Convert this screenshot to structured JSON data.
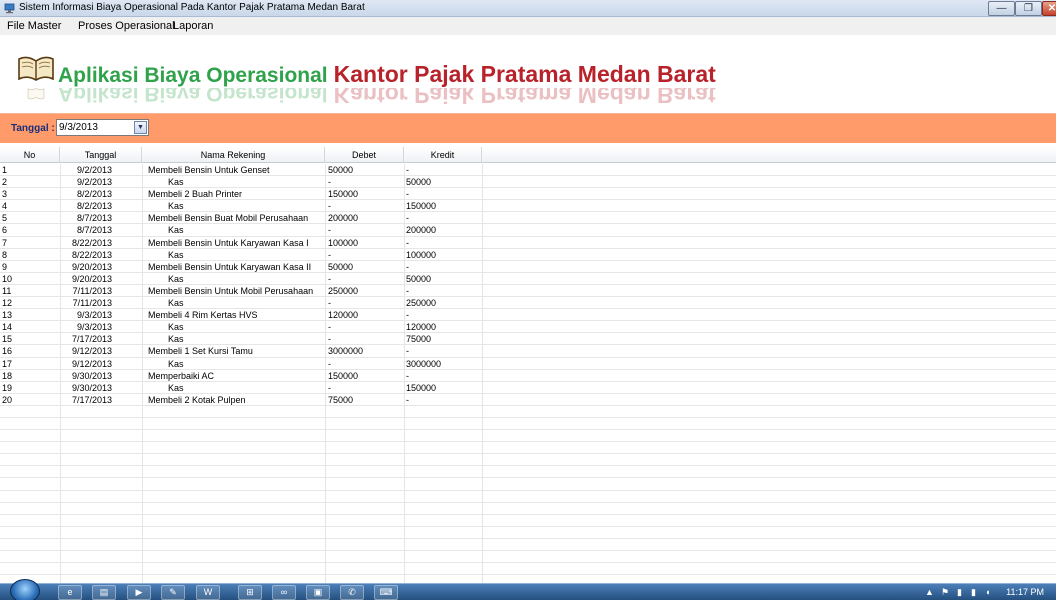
{
  "window": {
    "title": "Sistem Informasi Biaya Operasional Pada Kantor Pajak Pratama Medan Barat",
    "minimize_glyph": "—",
    "restore_glyph": "❐",
    "close_glyph": "✕"
  },
  "menu": {
    "items": [
      "File Master",
      "Proses Operasional",
      "Laporan"
    ]
  },
  "banner": {
    "title_green": "Aplikasi Biaya Operasional",
    "title_red": "Kantor Pajak Pratama Medan Barat",
    "colors": {
      "green": "#2fa24a",
      "red": "#b8222a"
    }
  },
  "filter": {
    "label": "Tanggal :",
    "date_value": "9/3/2013",
    "bar_color": "#ff9a6b"
  },
  "grid": {
    "columns": [
      "No",
      "Tanggal",
      "Nama Rekening",
      "Debet",
      "Kredit"
    ],
    "rows": [
      {
        "no": "1",
        "tanggal": "9/2/2013",
        "nama": "Membeli Bensin Untuk Genset",
        "debet": "50000",
        "kredit": "-"
      },
      {
        "no": "2",
        "tanggal": "9/2/2013",
        "nama": "Kas",
        "debet": "-",
        "kredit": "50000"
      },
      {
        "no": "3",
        "tanggal": "8/2/2013",
        "nama": "Membeli 2 Buah Printer",
        "debet": "150000",
        "kredit": "-"
      },
      {
        "no": "4",
        "tanggal": "8/2/2013",
        "nama": "Kas",
        "debet": "-",
        "kredit": "150000"
      },
      {
        "no": "5",
        "tanggal": "8/7/2013",
        "nama": "Membeli Bensin Buat Mobil Perusahaan",
        "debet": "200000",
        "kredit": "-"
      },
      {
        "no": "6",
        "tanggal": "8/7/2013",
        "nama": "Kas",
        "debet": "-",
        "kredit": "200000"
      },
      {
        "no": "7",
        "tanggal": "8/22/2013",
        "nama": "Membeli Bensin Untuk Karyawan Kasa I",
        "debet": "100000",
        "kredit": "-"
      },
      {
        "no": "8",
        "tanggal": "8/22/2013",
        "nama": "Kas",
        "debet": "-",
        "kredit": "100000"
      },
      {
        "no": "9",
        "tanggal": "9/20/2013",
        "nama": "Membeli Bensin Untuk Karyawan Kasa II",
        "debet": "50000",
        "kredit": "-"
      },
      {
        "no": "10",
        "tanggal": "9/20/2013",
        "nama": "Kas",
        "debet": "-",
        "kredit": "50000"
      },
      {
        "no": "11",
        "tanggal": "7/11/2013",
        "nama": "Membeli Bensin Untuk Mobil Perusahaan",
        "debet": "250000",
        "kredit": "-"
      },
      {
        "no": "12",
        "tanggal": "7/11/2013",
        "nama": "Kas",
        "debet": "-",
        "kredit": "250000"
      },
      {
        "no": "13",
        "tanggal": "9/3/2013",
        "nama": "Membeli 4 Rim Kertas HVS",
        "debet": "120000",
        "kredit": "-"
      },
      {
        "no": "14",
        "tanggal": "9/3/2013",
        "nama": "Kas",
        "debet": "-",
        "kredit": "120000"
      },
      {
        "no": "15",
        "tanggal": "7/17/2013",
        "nama": "Kas",
        "debet": "-",
        "kredit": "75000"
      },
      {
        "no": "16",
        "tanggal": "9/12/2013",
        "nama": "Membeli 1 Set Kursi Tamu",
        "debet": "3000000",
        "kredit": "-"
      },
      {
        "no": "17",
        "tanggal": "9/12/2013",
        "nama": "Kas",
        "debet": "-",
        "kredit": "3000000"
      },
      {
        "no": "18",
        "tanggal": "9/30/2013",
        "nama": "Memperbaiki AC",
        "debet": "150000",
        "kredit": "-"
      },
      {
        "no": "19",
        "tanggal": "9/30/2013",
        "nama": "Kas",
        "debet": "-",
        "kredit": "150000"
      },
      {
        "no": "20",
        "tanggal": "7/17/2013",
        "nama": "Membeli 2 Kotak Pulpen",
        "debet": "75000",
        "kredit": "-"
      }
    ]
  },
  "taskbar": {
    "clock": "11:17 PM",
    "tray_glyphs": [
      "▲",
      "⚑",
      "▮",
      "▮",
      "◖"
    ],
    "apps": [
      "e",
      "▤",
      "▶",
      "✎",
      "W",
      "⊞",
      "∞",
      "▣",
      "✆",
      "⌨"
    ]
  }
}
